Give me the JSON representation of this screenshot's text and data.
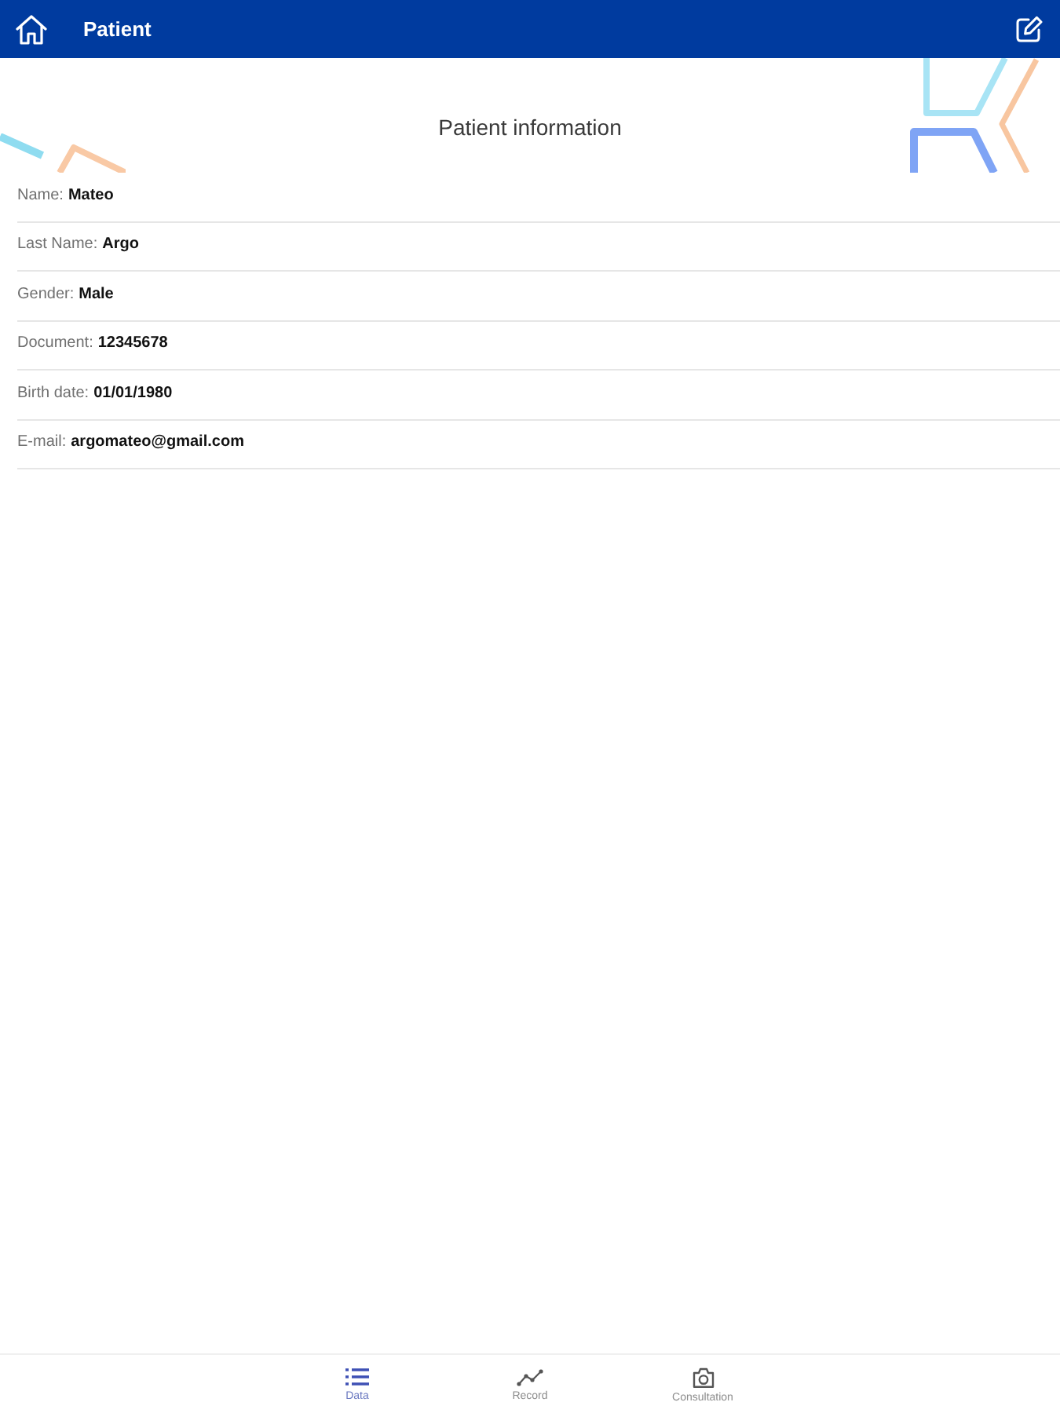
{
  "header": {
    "title": "Patient"
  },
  "section_title": "Patient information",
  "fields": [
    {
      "label": "Name:",
      "value": "Mateo"
    },
    {
      "label": "Last Name:",
      "value": "Argo"
    },
    {
      "label": "Gender:",
      "value": "Male"
    },
    {
      "label": "Document:",
      "value": "12345678"
    },
    {
      "label": "Birth date:",
      "value": "01/01/1980"
    },
    {
      "label": "E-mail:",
      "value": "argomateo@gmail.com"
    }
  ],
  "tabs": [
    {
      "label": "Data",
      "selected": true
    },
    {
      "label": "Record",
      "selected": false
    },
    {
      "label": "Consultation",
      "selected": false
    }
  ]
}
